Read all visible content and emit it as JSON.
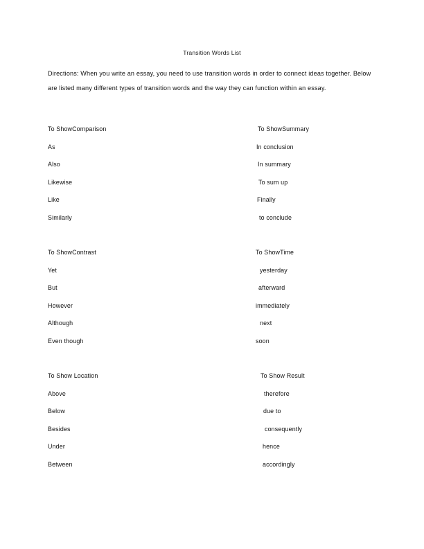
{
  "document": {
    "title": "Transition Words List",
    "directions": "Directions: When you write an essay, you need to use transition words in order to connect ideas together. Below are listed many different types of transition words and the way they can function within an essay."
  },
  "sections": [
    {
      "left": {
        "heading": "To ShowComparison",
        "words": [
          "As",
          "Also",
          "Likewise",
          "Like",
          "Similarly"
        ],
        "indents": [
          0,
          0,
          0,
          0,
          0
        ]
      },
      "right": {
        "heading": "To ShowSummary",
        "heading_indent": 3,
        "words": [
          "In conclusion",
          "In summary",
          "To sum up",
          "Finally",
          "to conclude"
        ],
        "indents": [
          1,
          3,
          4,
          2,
          5
        ]
      }
    },
    {
      "left": {
        "heading": "To ShowContrast",
        "words": [
          "Yet",
          "But",
          "However",
          "Although",
          "Even though"
        ],
        "indents": [
          0,
          0,
          0,
          0,
          0
        ]
      },
      "right": {
        "heading": "To ShowTime",
        "heading_indent": 0,
        "words": [
          "yesterday",
          "afterward",
          "immediately",
          "next",
          "soon"
        ],
        "indents": [
          6,
          4,
          0,
          6,
          0
        ]
      }
    },
    {
      "left": {
        "heading": "To Show Location",
        "words": [
          "Above",
          "Below",
          "Besides",
          "Under",
          "Between"
        ],
        "indents": [
          0,
          0,
          0,
          0,
          0
        ]
      },
      "right": {
        "heading": "To Show Result",
        "heading_indent": 7,
        "words": [
          "therefore",
          "due to",
          "consequently",
          "hence",
          "accordingly"
        ],
        "indents": [
          12,
          11,
          13,
          10,
          10
        ]
      }
    }
  ],
  "colors": {
    "page_background": "#ffffff",
    "text": "#111111"
  }
}
